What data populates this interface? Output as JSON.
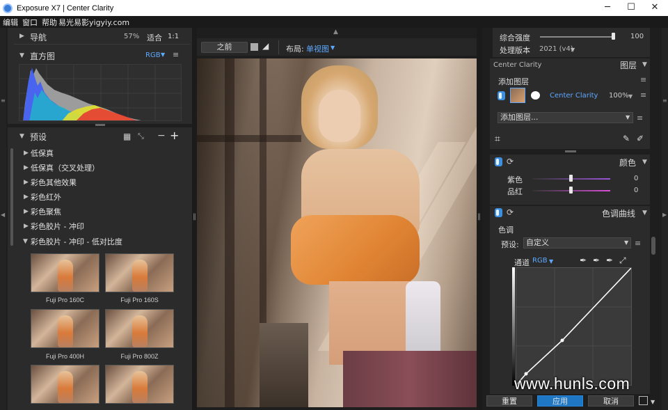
{
  "window": {
    "title": "Exposure X7 | Center Clarity",
    "minimize": "─",
    "maximize": "☐",
    "close": "✕"
  },
  "menu": {
    "items": [
      "编辑",
      "窗口",
      "帮助",
      "易光易影yigyiy.com"
    ]
  },
  "nav": {
    "label": "导航",
    "zoom": "57%",
    "fit": "适合",
    "ratio": "1:1"
  },
  "histogram": {
    "label": "直方图",
    "channel": "RGB"
  },
  "presets": {
    "label": "预设",
    "items": [
      "低保真",
      "低保真（交叉处理）",
      "彩色其他效果",
      "彩色红外",
      "彩色聚焦",
      "彩色胶片 - 冲印",
      "彩色胶片 - 冲印 - 低对比度"
    ],
    "thumbs": [
      "Fuji Pro 160C",
      "Fuji Pro 160S",
      "Fuji Pro 400H",
      "Fuji Pro 800Z"
    ]
  },
  "viewer": {
    "before": "之前",
    "layout_label": "布局:",
    "layout_value": "单视图"
  },
  "right": {
    "strength_label": "综合强度",
    "strength_value": "100",
    "strength_level": 0.98,
    "version_label": "处理版本",
    "version_value": "2021 (v4)",
    "preset_name": "Center Clarity",
    "layers_label": "图层",
    "add_layer_title": "添加图层",
    "layer_name": "Center Clarity",
    "layer_opacity": "100%",
    "add_layer_dropdown": "添加图层..."
  },
  "color": {
    "label": "颜色",
    "purple_label": "紫色",
    "purple_value": "0",
    "magenta_label": "品红",
    "magenta_value": "0"
  },
  "curves": {
    "label": "色调曲线",
    "sub_label": "色调",
    "preset_label": "预设:",
    "preset_value": "自定义",
    "channel_label": "通道",
    "channel_value": "RGB"
  },
  "buttons": {
    "reset": "重置",
    "apply": "应用",
    "cancel": "取消"
  },
  "watermark": "www.hunls.com",
  "colors": {
    "accent": "#5ea9ff",
    "apply_bg": "#1f76c2",
    "toggle": "#3d8fe0"
  },
  "icons": [
    "camera-aperture-icon",
    "grid-icon",
    "collapse-icon",
    "minus-icon",
    "plus-icon",
    "list-menu-icon",
    "crop-icon",
    "brush-icon",
    "eyedropper-icon",
    "expand-icon"
  ]
}
